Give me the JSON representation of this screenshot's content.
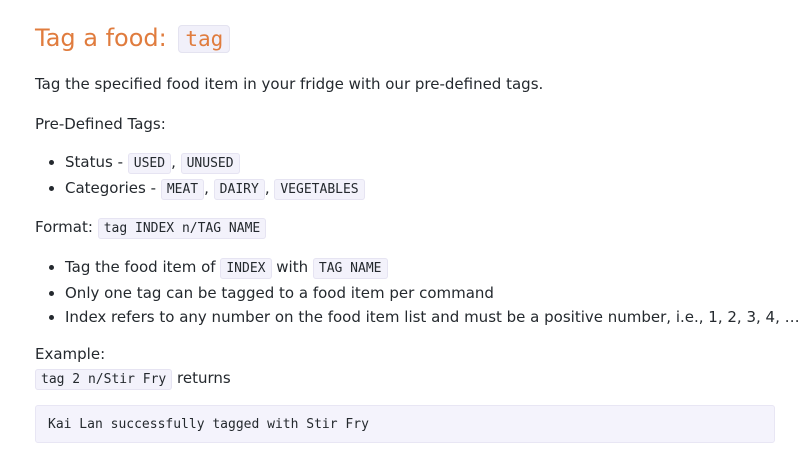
{
  "heading": {
    "text": "Tag a food: ",
    "code": "tag"
  },
  "description": "Tag the specified food item in your fridge with our pre-defined tags.",
  "predefined_tags": {
    "label": "Pre-Defined Tags:",
    "status": {
      "label": "Status - ",
      "tags": [
        "USED",
        "UNUSED"
      ]
    },
    "categories": {
      "label": "Categories - ",
      "tags": [
        "MEAT",
        "DAIRY",
        "VEGETABLES"
      ]
    },
    "separator": ", "
  },
  "format": {
    "label": "Format: ",
    "code": "tag INDEX n/TAG NAME"
  },
  "notes": {
    "item1": {
      "prefix": "Tag the food item of ",
      "code1": "INDEX",
      "middle": " with ",
      "code2": "TAG NAME"
    },
    "item2": "Only one tag can be tagged to a food item per command",
    "item3": "Index refers to any number on the food item list and must be a positive number, i.e., 1, 2, 3, 4, …"
  },
  "example": {
    "label": "Example:",
    "command": "tag 2 n/Stir Fry",
    "returns": " returns",
    "output": "Kai Lan successfully tagged with Stir Fry"
  }
}
